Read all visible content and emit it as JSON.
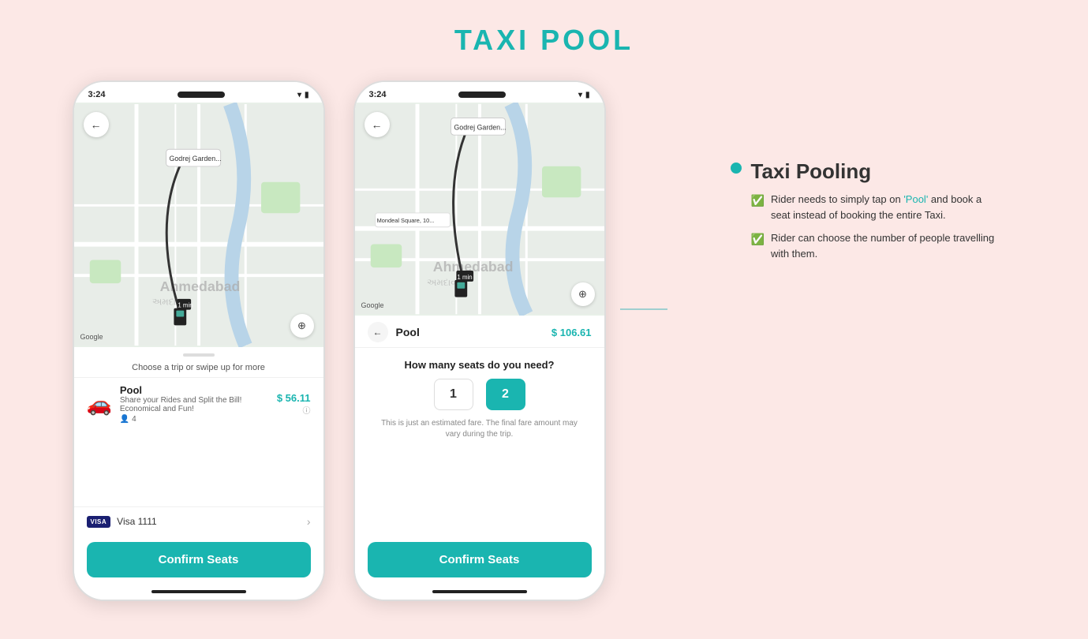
{
  "page": {
    "title": "TAXI POOL",
    "background": "#fce8e6"
  },
  "phone1": {
    "status_time": "3:24",
    "map_label": "Ahmedabad",
    "map_label_guj": "અમદાવાડ",
    "panel_hint": "Choose a trip or swipe up for more",
    "pool_option": {
      "title": "Pool",
      "desc": "Share your Rides and Split the Bill! Economical and Fun!",
      "seats": "4",
      "price": "$ 56.11",
      "info_icon": "ⓘ"
    },
    "payment": {
      "card_label": "VISA",
      "card_number": "Visa 1111"
    },
    "confirm_btn": "Confirm Seats",
    "google_label": "Google"
  },
  "phone2": {
    "status_time": "3:24",
    "map_label": "Ahmedabad",
    "map_label_guj": "અમદાવાડ",
    "panel": {
      "back_label": "←",
      "title": "Pool",
      "price": "$ 106.61",
      "question": "How many seats do you need?",
      "seat_options": [
        "1",
        "2"
      ],
      "active_seat": "2",
      "fare_note": "This is just an estimated fare. The final fare amount may vary during the trip."
    },
    "confirm_btn": "Confirm Seats",
    "google_label": "Google"
  },
  "annotation": {
    "heading": "Taxi Pooling",
    "dot_color": "#1ab5b0",
    "items": [
      {
        "text_plain": "Rider needs to simply tap on 'Pool' and book a seat instead of booking the entire Taxi.",
        "highlight_word": "Pool"
      },
      {
        "text_plain": "Rider can choose the number of people travelling with them.",
        "highlight_word": ""
      }
    ]
  }
}
